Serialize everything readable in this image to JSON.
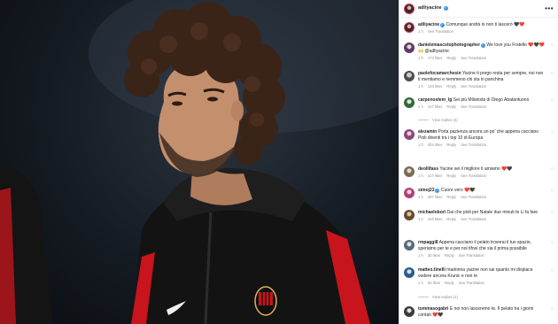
{
  "post": {
    "username": "adliyacine",
    "verified": true,
    "more_icon": "more-horizontal-icon"
  },
  "comments": [
    {
      "username": "adliyacine",
      "verified": true,
      "text": "Comunque andrà io non ti lascerò 🖤❤️",
      "time": "1 h",
      "likes": "",
      "reply": "",
      "translation": "See Translation"
    },
    {
      "username": "danielemascolophotographer",
      "verified": true,
      "text": "We love you Fratello ❤️🖤❤️ 🙌 @adliyacine",
      "time": "1 h",
      "likes": "173 likes",
      "reply": "Reply",
      "translation": "See Translation"
    },
    {
      "username": "paolofocamarchesin",
      "verified": false,
      "text": "Yacine ti prego resta per sempre, noi non ti mentiamo e nemmeno chi sta in panchina",
      "time": "1 h",
      "likes": "133 likes",
      "reply": "Reply",
      "translation": "See Translation"
    },
    {
      "username": "carpenostem_lg",
      "verified": false,
      "text": "Sei più Milanista di Diego Abatantuono",
      "time": "1 h",
      "likes": "217 likes",
      "reply": "Reply",
      "translation": "See Translation",
      "view_replies": "View replies (2)"
    },
    {
      "username": "alezamin",
      "verified": false,
      "text": "Porta pazienza ancora un po' che appena cacciano Pioli diventi tra i top 10 di Europa",
      "time": "1 h",
      "likes": "304 likes",
      "reply": "Reply",
      "translation": "See Translation"
    },
    {
      "username": "deollifass",
      "verified": false,
      "text": "Yacine sei il migliore ti amiamo ❤️🖤",
      "time": "1 h",
      "likes": "217 likes",
      "reply": "Reply",
      "translation": "See Translation"
    },
    {
      "username": "simoj22",
      "verified": true,
      "text": "Cuore vero ❤️🖤",
      "time": "1 h",
      "likes": "287 likes",
      "reply": "Reply",
      "translation": "See Translation"
    },
    {
      "username": "michaelobori",
      "verified": false,
      "text": "Dai che pioli per Natale due minuti te Li fa fare",
      "time": "1 h",
      "likes": "149 likes",
      "reply": "Reply",
      "translation": "See Translation"
    },
    {
      "username": "rmpaggi8",
      "verified": false,
      "text": "Appena cacciano il pelato troverai il tuo spazio, speriamo per te e per noi tifosi che sia il prima possibile",
      "time": "1 h",
      "likes": "30 likes",
      "reply": "Reply",
      "translation": "See Translation"
    },
    {
      "username": "matteo.tinelli",
      "verified": false,
      "text": "madonna yacine non sai quanto mi dispiace vedere ancora Krunic e non te",
      "time": "1 h",
      "likes": "62 likes",
      "reply": "Reply",
      "translation": "See Translation",
      "view_replies": "View replies (1)"
    },
    {
      "username": "tommasogabri",
      "verified": false,
      "text": "E noi non lasceremo te. Il pelato ha i giorni contati ❤️🖤",
      "time": "1 h",
      "likes": "",
      "reply": "",
      "translation": ""
    }
  ]
}
